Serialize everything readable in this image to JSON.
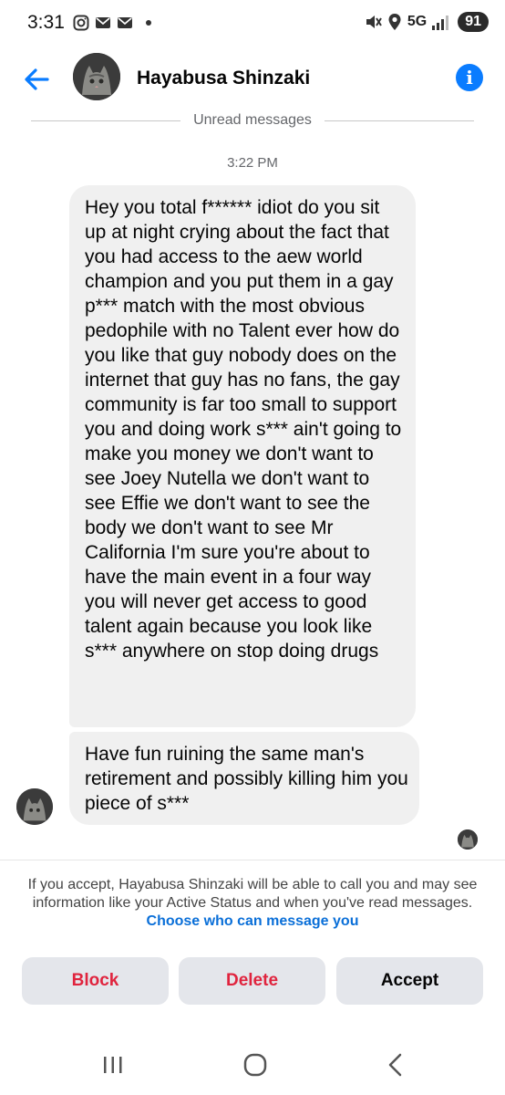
{
  "status_bar": {
    "time": "3:31",
    "network": "5G",
    "battery": "91",
    "icons": [
      "instagram-icon",
      "mail-icon",
      "mail-icon",
      "dot-icon",
      "mute-icon",
      "location-icon",
      "signal-icon"
    ]
  },
  "header": {
    "contact_name": "Hayabusa Shinzaki",
    "info_icon": "i"
  },
  "thread": {
    "unread_label": "Unread messages",
    "timestamp": "3:22 PM",
    "messages": [
      {
        "text": "Hey you total f****** idiot do you sit up at night crying about the fact that you had access to the aew world champion and you put them in a gay p*** match with the most obvious pedophile with no Talent ever how do you like that guy nobody does on the internet that guy has no fans, the gay community is far too small to support you and doing work s*** ain't going to make you money we don't want to see Joey Nutella we don't want to see Effie we don't want to see the body we don't want to see Mr California I'm sure you're about to have the main event in a four way you will never get access to good talent again because you look like s*** anywhere on stop doing drugs"
      },
      {
        "text": "Have fun ruining the same man's retirement and possibly killing him you piece of s***"
      }
    ]
  },
  "request": {
    "notice": "If you accept, Hayabusa Shinzaki will be able to call you and may see information like your Active Status and when you've read messages.",
    "link": "Choose who can message you",
    "buttons": {
      "block": "Block",
      "delete": "Delete",
      "accept": "Accept"
    }
  },
  "colors": {
    "accent": "#0a7cff",
    "destructive": "#e0243e",
    "bubble": "#f0f0f0",
    "button_bg": "#e4e6eb"
  }
}
